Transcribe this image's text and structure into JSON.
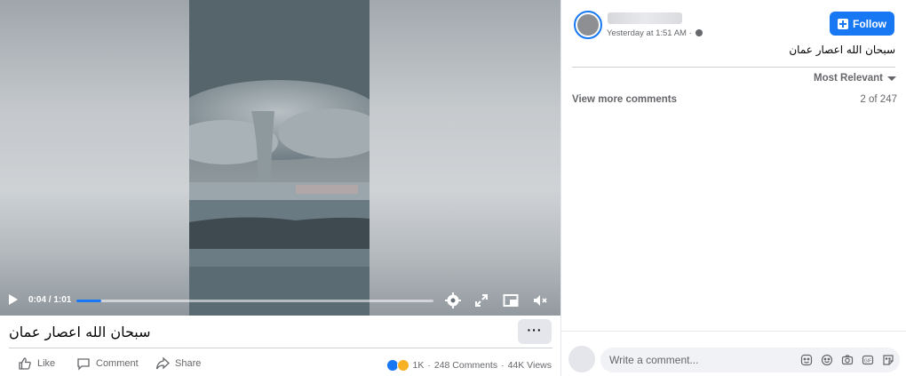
{
  "video": {
    "time": "0:04 / 1:01",
    "progress": 0.07,
    "title": "سبحان الله اعصار عمان",
    "more_label": "···"
  },
  "actions": {
    "like": "Like",
    "comment": "Comment",
    "share": "Share"
  },
  "stats": {
    "reactions": "1K",
    "comments": "248 Comments",
    "views": "44K Views"
  },
  "post": {
    "timestamp": "Yesterday at 1:51 AM · ",
    "follow_label": "Follow",
    "caption": "سبحان الله اعصار عمان"
  },
  "comments": {
    "sort_label": "Most Relevant",
    "view_more": "View more comments",
    "count": "2 of 247",
    "placeholder": "Write a comment..."
  },
  "colors": {
    "accent": "#1877f2",
    "secondary_text": "#65676b"
  }
}
